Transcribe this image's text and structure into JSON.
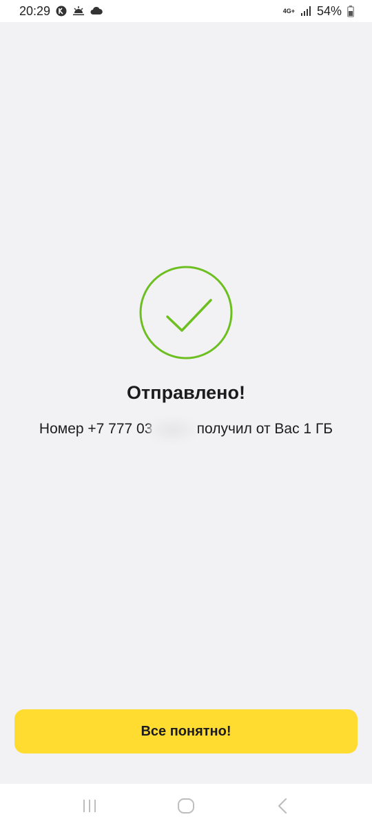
{
  "status_bar": {
    "time": "20:29",
    "network_type": "4G+",
    "battery": "54%",
    "icons": [
      "gallery-notification-icon",
      "weather-sunrise-icon",
      "cloud-icon",
      "signal-icon",
      "battery-icon"
    ]
  },
  "result": {
    "title": "Отправлено!",
    "message_prefix": "Номер +7 777 03",
    "message_masked": "00000",
    "message_suffix": " получил от Вас 1 ГБ",
    "success_color": "#6cbf1f"
  },
  "actions": {
    "confirm_label": "Все понятно!",
    "confirm_color": "#ffdc2f"
  },
  "nav_bar": {
    "icons": [
      "recents-icon",
      "home-icon",
      "back-icon"
    ]
  }
}
